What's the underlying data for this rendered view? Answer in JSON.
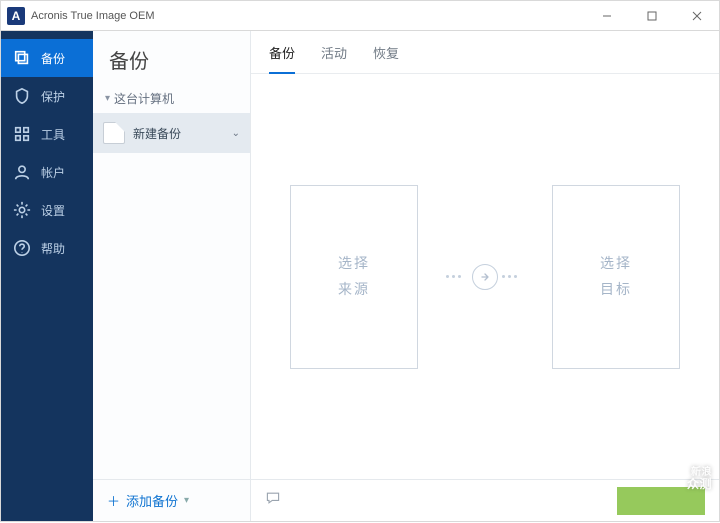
{
  "app": {
    "title": "Acronis True Image OEM",
    "icon_letter": "A"
  },
  "sidebar": {
    "items": [
      {
        "label": "备份"
      },
      {
        "label": "保护"
      },
      {
        "label": "工具"
      },
      {
        "label": "帐户"
      },
      {
        "label": "设置"
      },
      {
        "label": "帮助"
      }
    ]
  },
  "panel2": {
    "header": "备份",
    "subhead": "这台计算机",
    "items": [
      {
        "label": "新建备份"
      }
    ],
    "add_label": "添加备份"
  },
  "main": {
    "tabs": [
      {
        "label": "备份"
      },
      {
        "label": "活动"
      },
      {
        "label": "恢复"
      }
    ],
    "source_box": {
      "l1": "选择",
      "l2": "来源"
    },
    "dest_box": {
      "l1": "选择",
      "l2": "目标"
    }
  },
  "watermark": {
    "line1": "新浪",
    "line2": "众测"
  }
}
